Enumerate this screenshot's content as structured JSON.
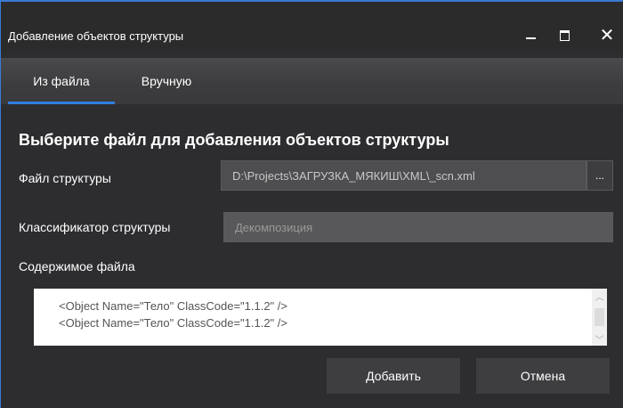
{
  "window": {
    "title": "Добавление объектов структуры",
    "controls": {
      "minimize_icon": "minimize-icon",
      "maximize_icon": "maximize-icon",
      "close_icon": "close-icon",
      "close_glyph": "✕"
    }
  },
  "tabs": [
    {
      "label": "Из файла",
      "active": true
    },
    {
      "label": "Вручную",
      "active": false
    }
  ],
  "form": {
    "heading": "Выберите файл для добавления объектов структуры",
    "file_label": "Файл структуры",
    "file_value": "D:\\Projects\\ЗАГРУЗКА_МЯКИШ\\XML\\_scn.xml",
    "browse_label": "...",
    "classifier_label": "Классификатор структуры",
    "classifier_value": "Декомпозиция",
    "content_label": "Содержимое файла",
    "content_lines": [
      "<Object Name=\"Тело\" ClassCode=\"1.1.2\" />",
      "<Object Name=\"Тело\" ClassCode=\"1.1.2\" />"
    ]
  },
  "buttons": {
    "add_label": "Добавить",
    "cancel_label": "Отмена"
  },
  "colors": {
    "accent": "#2f7fe0",
    "background": "#2d2d30",
    "titlebar": "#2b2b2b"
  }
}
